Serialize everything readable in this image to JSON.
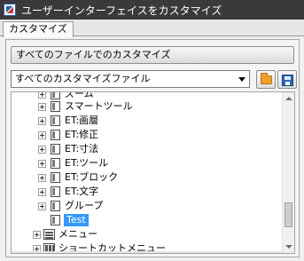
{
  "window": {
    "title": "ユーザーインターフェイスをカスタマイズ"
  },
  "tabs": [
    {
      "label": "カスタマイズ"
    }
  ],
  "customize": {
    "all_files_label": "すべてのファイルでのカスタマイズ",
    "file_selector": {
      "selected": "すべてのカスタマイズファイル"
    }
  },
  "tree": {
    "items": [
      {
        "label": "ズーム"
      },
      {
        "label": "スマートツール"
      },
      {
        "label": "ET:画層"
      },
      {
        "label": "ET:修正"
      },
      {
        "label": "ET:寸法"
      },
      {
        "label": "ET:ツール"
      },
      {
        "label": "ET:ブロック"
      },
      {
        "label": "ET:文字"
      },
      {
        "label": "グループ"
      },
      {
        "label": "Test"
      }
    ],
    "groups": [
      {
        "label": "メニュー"
      },
      {
        "label": "ショートカットメニュー"
      }
    ]
  },
  "colors": {
    "titlebar": "#3a3a3a",
    "selection": "#3399ff",
    "folder": "#f0a030",
    "save": "#2c68b3"
  }
}
